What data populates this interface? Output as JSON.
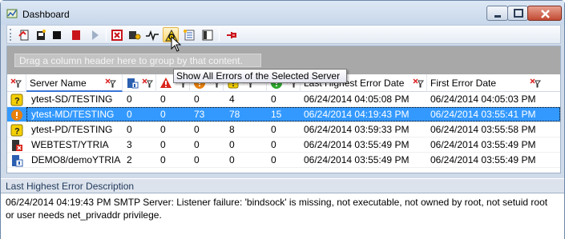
{
  "window": {
    "title": "Dashboard"
  },
  "toolbar": {
    "hot_index": 8
  },
  "tooltip": {
    "text": "Show All Errors of the Selected Server"
  },
  "grid": {
    "group_hint": "Drag a column header here to group by that content.",
    "headers": {
      "server_name": "Server Name",
      "last_highest_error_date": "Last Highest Error Date",
      "first_error_date": "First Error Date"
    },
    "rows": [
      {
        "status_icon": "question-icon",
        "server": "ytest-SD/TESTING",
        "c1": "0",
        "c2": "0",
        "c3": "0",
        "c4": "4",
        "c5": "0",
        "last": "06/24/2014 04:05:08 PM",
        "first": "06/24/2014 04:05:03 PM",
        "selected": false
      },
      {
        "status_icon": "error-icon",
        "server": "ytest-MD/TESTING",
        "c1": "0",
        "c2": "0",
        "c3": "73",
        "c4": "78",
        "c5": "15",
        "last": "06/24/2014 04:19:43 PM",
        "first": "06/24/2014 03:55:41 PM",
        "selected": true
      },
      {
        "status_icon": "question-icon",
        "server": "ytest-PD/TESTING",
        "c1": "0",
        "c2": "0",
        "c3": "0",
        "c4": "8",
        "c5": "0",
        "last": "06/24/2014 03:59:33 PM",
        "first": "06/24/2014 03:55:58 PM",
        "selected": false
      },
      {
        "status_icon": "server-down-icon",
        "server": "WEBTEST/YTRIA",
        "c1": "3",
        "c2": "0",
        "c3": "0",
        "c4": "0",
        "c5": "0",
        "last": "06/24/2014 03:55:49 PM",
        "first": "06/24/2014 03:55:49 PM",
        "selected": false
      },
      {
        "status_icon": "server-info-icon",
        "server": "DEMO8/demoYTRIA",
        "c1": "2",
        "c2": "0",
        "c3": "0",
        "c4": "0",
        "c5": "0",
        "last": "06/24/2014 03:55:49 PM",
        "first": "06/24/2014 03:55:49 PM",
        "selected": false
      }
    ]
  },
  "description": {
    "label": "Last Highest Error Description",
    "text": "06/24/2014 04:19:43 PM  SMTP Server: Listener failure: 'bindsock' is missing, not executable, not owned by root, not setuid root or user needs net_privaddr privilege."
  },
  "colors": {
    "selection": "#3399ff",
    "accent": "#3875d7",
    "error_red": "#d9261c",
    "warning_yellow": "#f5d000"
  }
}
